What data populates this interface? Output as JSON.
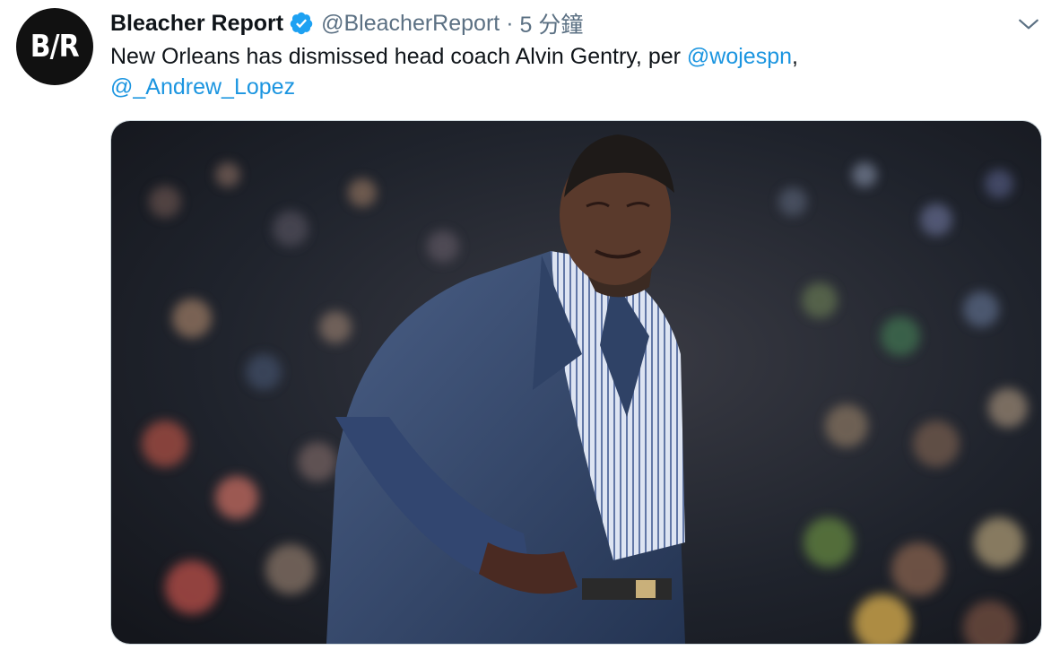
{
  "tweet": {
    "author": {
      "display_name": "Bleacher Report",
      "handle": "@BleacherReport",
      "avatar_text": "B/R",
      "verified": true
    },
    "separator": "·",
    "timestamp": "5 分鐘",
    "text_before": "New Orleans has dismissed head coach Alvin Gentry, per ",
    "mention_1": "@wojespn",
    "text_between": ",",
    "mention_2": "@_Andrew_Lopez",
    "media": {
      "kind": "photo"
    }
  },
  "icons": {
    "verified": "verified-badge-icon",
    "more": "chevron-down-icon"
  },
  "colors": {
    "text": "#0f1419",
    "secondary": "#5b7083",
    "link": "#1b95e0",
    "verified": "#1da1f2"
  }
}
